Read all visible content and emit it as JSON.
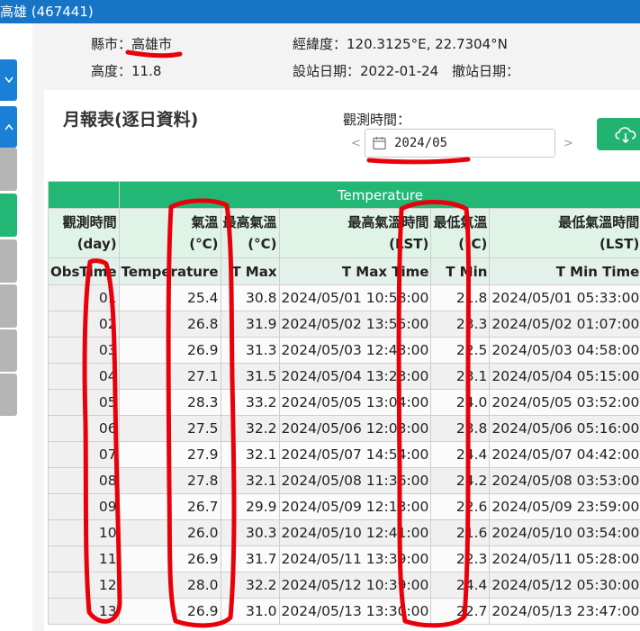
{
  "window": {
    "title": "高雄 (467441)"
  },
  "station": {
    "city_label": "縣市：",
    "city": "高雄市",
    "coord_label": "經緯度：",
    "coord": "120.3125°E, 22.7304°N",
    "alt_label": "高度：",
    "alt": "11.8",
    "est_label": "設站日期：",
    "est": "2022-01-24",
    "removed_label": "撤站日期："
  },
  "report": {
    "heading": "月報表(逐日資料)",
    "obs_time_label": "觀測時間：",
    "month": "2024/05",
    "prev": "<",
    "next": ">"
  },
  "table": {
    "group_label": "Temperature",
    "headers": [
      {
        "zh": "觀測時間",
        "unit": "(day)",
        "code": "ObsTime"
      },
      {
        "zh": "氣溫",
        "unit": "(°C)",
        "code": "Temperature"
      },
      {
        "zh": "最高氣溫",
        "unit": "(°C)",
        "code": "T Max"
      },
      {
        "zh": "最高氣溫時間",
        "unit": "(LST)",
        "code": "T Max Time"
      },
      {
        "zh": "最低氣溫",
        "unit": "(°C)",
        "code": "T Min"
      },
      {
        "zh": "最低氣溫時間",
        "unit": "(LST)",
        "code": "T Min Time"
      }
    ],
    "rows": [
      [
        "01",
        "25.4",
        "30.8",
        "2024/05/01 10:58:00",
        "21.8",
        "2024/05/01 05:33:00"
      ],
      [
        "02",
        "26.8",
        "31.9",
        "2024/05/02 13:55:00",
        "23.3",
        "2024/05/02 01:07:00"
      ],
      [
        "03",
        "26.9",
        "31.3",
        "2024/05/03 12:43:00",
        "22.5",
        "2024/05/03 04:58:00"
      ],
      [
        "04",
        "27.1",
        "31.5",
        "2024/05/04 13:23:00",
        "23.1",
        "2024/05/04 05:15:00"
      ],
      [
        "05",
        "28.3",
        "33.2",
        "2024/05/05 13:04:00",
        "24.0",
        "2024/05/05 03:52:00"
      ],
      [
        "06",
        "27.5",
        "32.2",
        "2024/05/06 12:03:00",
        "23.8",
        "2024/05/06 05:16:00"
      ],
      [
        "07",
        "27.9",
        "32.1",
        "2024/05/07 14:54:00",
        "24.4",
        "2024/05/07 04:42:00"
      ],
      [
        "08",
        "27.8",
        "32.1",
        "2024/05/08 11:36:00",
        "24.2",
        "2024/05/08 03:53:00"
      ],
      [
        "09",
        "26.7",
        "29.9",
        "2024/05/09 12:13:00",
        "22.6",
        "2024/05/09 23:59:00"
      ],
      [
        "10",
        "26.0",
        "30.3",
        "2024/05/10 12:41:00",
        "21.6",
        "2024/05/10 03:54:00"
      ],
      [
        "11",
        "26.9",
        "31.7",
        "2024/05/11 13:39:00",
        "22.3",
        "2024/05/11 05:28:00"
      ],
      [
        "12",
        "28.0",
        "32.2",
        "2024/05/12 10:39:00",
        "24.4",
        "2024/05/12 05:30:00"
      ],
      [
        "13",
        "26.9",
        "31.0",
        "2024/05/13 13:30:00",
        "22.7",
        "2024/05/13 23:47:00"
      ]
    ]
  },
  "colors": {
    "accent": "#23b776",
    "title_bar": "#1675c6",
    "annotation": "#e8000b"
  }
}
